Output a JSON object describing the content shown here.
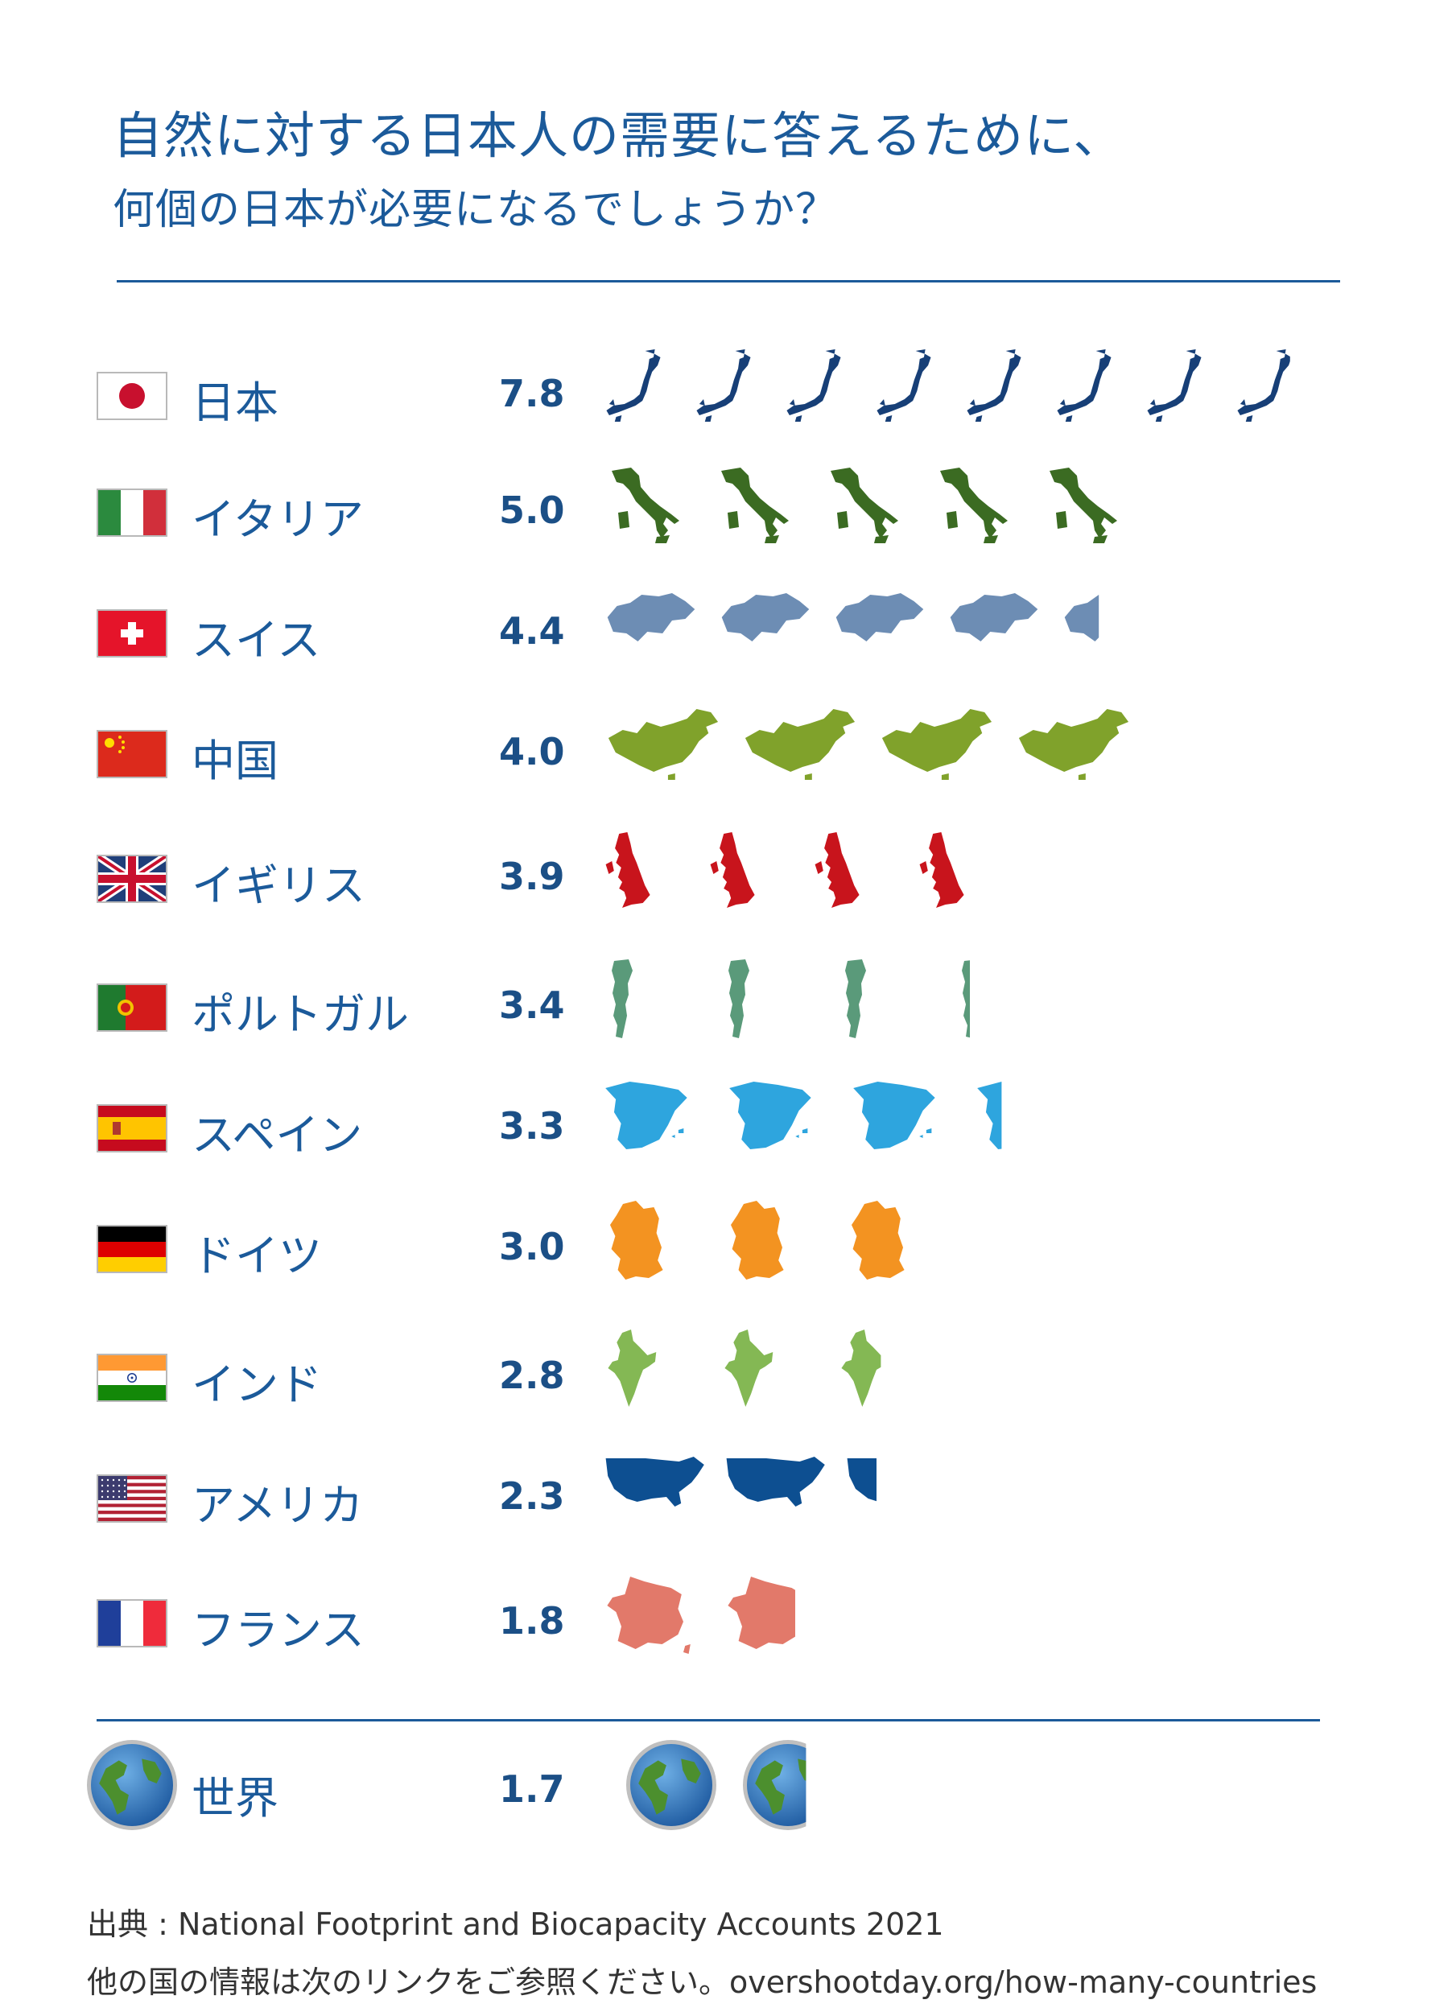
{
  "header": {
    "title": "自然に対する日本人の需要に答えるために、",
    "subtitle": "何個の日本が必要になるでしょうか？"
  },
  "chart_data": {
    "type": "bar",
    "categories": [
      "日本",
      "イタリア",
      "スイス",
      "中国",
      "イギリス",
      "ポルトガル",
      "スペイン",
      "ドイツ",
      "インド",
      "アメリカ",
      "フランス",
      "世界"
    ],
    "values": [
      7.8,
      5.0,
      4.4,
      4.0,
      3.9,
      3.4,
      3.3,
      3.0,
      2.8,
      2.3,
      1.8,
      1.7
    ],
    "value_labels": [
      "7.8",
      "5.0",
      "4.4",
      "4.0",
      "3.9",
      "3.4",
      "3.3",
      "3.0",
      "2.8",
      "2.3",
      "1.8",
      "1.7"
    ],
    "colors": [
      "#173f77",
      "#3b6b22",
      "#6d8db4",
      "#80a22b",
      "#c8141c",
      "#5a9a7a",
      "#2ea5de",
      "#f39321",
      "#84b854",
      "#0d4f91",
      "#e2796a",
      "#2e6fb4"
    ],
    "icon_names": [
      "japan-icon",
      "italy-icon",
      "switzerland-icon",
      "china-icon",
      "uk-icon",
      "portugal-icon",
      "spain-icon",
      "germany-icon",
      "india-icon",
      "usa-icon",
      "france-icon",
      "globe-icon"
    ]
  },
  "source": {
    "line1": "出典 : National Footprint and Biocapacity Accounts 2021",
    "line2_prefix": "他の国の情報は次のリンクをご参照ください。",
    "line2_url": "overshootday.org/how-many-countries"
  }
}
